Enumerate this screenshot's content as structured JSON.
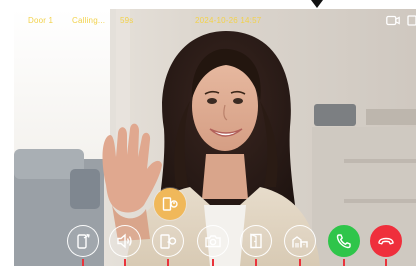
{
  "status_bar": {
    "door_label": "Door 1",
    "call_status": "Calling...",
    "call_timer": "59s",
    "datetime": "2024-10-26  14:57",
    "text_color": "#f2d24b"
  },
  "icons": {
    "top_right": [
      "record-indicator-icon",
      "window-icon"
    ],
    "floating": "unlock-door-icon",
    "controls": [
      "transfer-call-icon",
      "speaker-volume-icon",
      "unlock-door-icon",
      "snapshot-camera-icon",
      "open-gate-icon",
      "building-icon",
      "answer-call-icon",
      "hang-up-icon"
    ]
  },
  "colors": {
    "accent_lock": "#f0b85a",
    "answer": "#2fc54a",
    "hangup": "#ef2f3c",
    "marker": "#e9333b"
  }
}
